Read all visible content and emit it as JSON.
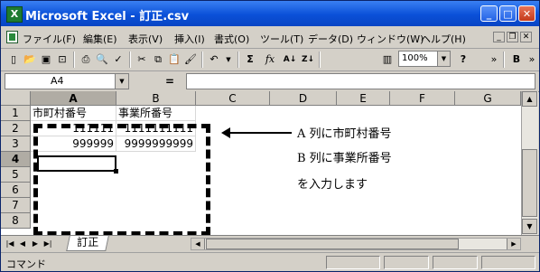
{
  "window": {
    "title": "Microsoft Excel - 訂正.csv",
    "app_icon": "excel-app-icon",
    "controls": {
      "minimize": "_",
      "maximize": "□",
      "close": "✕"
    }
  },
  "menu": {
    "items": [
      "ファイル(F)",
      "編集(E)",
      "表示(V)",
      "挿入(I)",
      "書式(O)",
      "ツール(T)",
      "データ(D)",
      "ウィンドウ(W)",
      "ヘルプ(H)"
    ],
    "doc_controls": {
      "minimize": "_",
      "restore": "❐",
      "close": "✕"
    }
  },
  "toolbar": {
    "icons": [
      "new-icon",
      "open-icon",
      "save-icon",
      "permission-icon",
      "print-icon",
      "print-preview-icon",
      "spelling-icon",
      "cut-icon",
      "copy-icon",
      "paste-icon",
      "format-painter-icon",
      "undo-icon",
      "autosum-icon",
      "function-icon",
      "sort-ascending-icon",
      "sort-descending-icon",
      "chart-wizard-icon",
      "help-icon",
      "bold-icon"
    ],
    "glyphs": {
      "undo": "↶",
      "sum": "Σ",
      "fx": "fx",
      "sort_asc": "A↓",
      "sort_desc": "Z↓",
      "bold": "B",
      "help": "?",
      "more": "»"
    },
    "zoom": "100%"
  },
  "formula_bar": {
    "name_box": "A4",
    "equals": "=",
    "content": ""
  },
  "grid": {
    "columns": [
      "A",
      "B",
      "C",
      "D",
      "E",
      "F",
      "G"
    ],
    "rows": [
      "1",
      "2",
      "3",
      "4",
      "5",
      "6",
      "7",
      "8"
    ],
    "selected_column": "A",
    "selected_row": "4",
    "cells": {
      "A1": "市町村番号",
      "B1": "事業所番号",
      "A2": "111111",
      "B2": "1111111111",
      "A3": "999999",
      "B3": "9999999999"
    }
  },
  "annotations": {
    "line1": "A 列に市町村番号",
    "line2": "B 列に事業所番号",
    "line3": "を入力します"
  },
  "sheet_tabs": {
    "active": "訂正"
  },
  "status": {
    "text": "コマンド"
  }
}
